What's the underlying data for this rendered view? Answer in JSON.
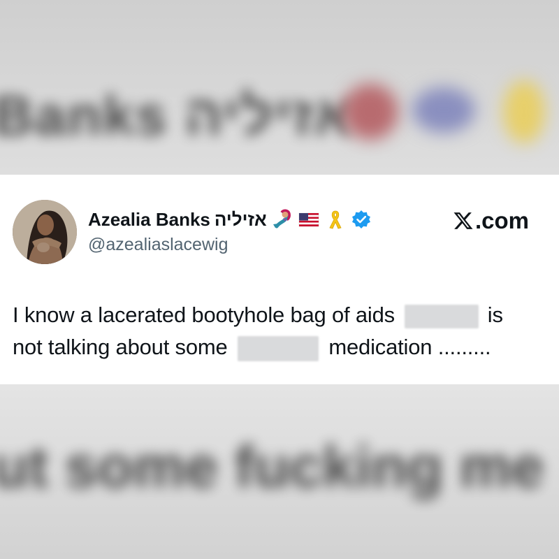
{
  "author": {
    "display_name": "Azealia Banks",
    "hebrew_name": "אזיליה",
    "handle": "@azealiaslacewig",
    "verified": true,
    "name_emojis": [
      "mermaid-icon",
      "us-flag-icon",
      "yellow-ribbon-icon"
    ]
  },
  "brand": {
    "label": ".com",
    "full": "X.com"
  },
  "tweet": {
    "line1_part1": "I know a lacerated bootyhole bag of aids",
    "line1_part2": "is",
    "line2_part1": "not talking about some",
    "line2_part2": "medication ........."
  },
  "background": {
    "blur_top": "Banks אזיליה",
    "blur_bottom": "ut some fucking me"
  },
  "colors": {
    "verified_blue": "#1d9bf0",
    "text": "#0f1419",
    "handle_gray": "#536471",
    "ribbon_yellow": "#f5c518"
  }
}
